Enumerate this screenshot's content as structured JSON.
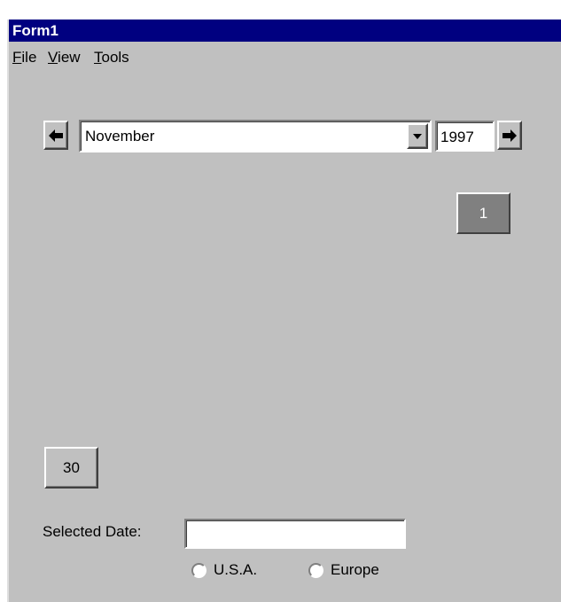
{
  "window": {
    "title": "Form1"
  },
  "menu": [
    {
      "mnemonic": "F",
      "rest": "ile"
    },
    {
      "mnemonic": "V",
      "rest": "iew"
    },
    {
      "mnemonic": "T",
      "rest": "ools"
    }
  ],
  "calendar": {
    "month": "November",
    "year": "1997",
    "first_day": "1",
    "last_day": "30"
  },
  "selected_date": {
    "label": "Selected Date:",
    "value": ""
  },
  "region": {
    "options": [
      "U.S.A.",
      "Europe"
    ],
    "selected": null
  },
  "icons": {
    "prev": "left-arrow-icon",
    "next": "right-arrow-icon",
    "dropdown": "dropdown-arrow-icon"
  }
}
